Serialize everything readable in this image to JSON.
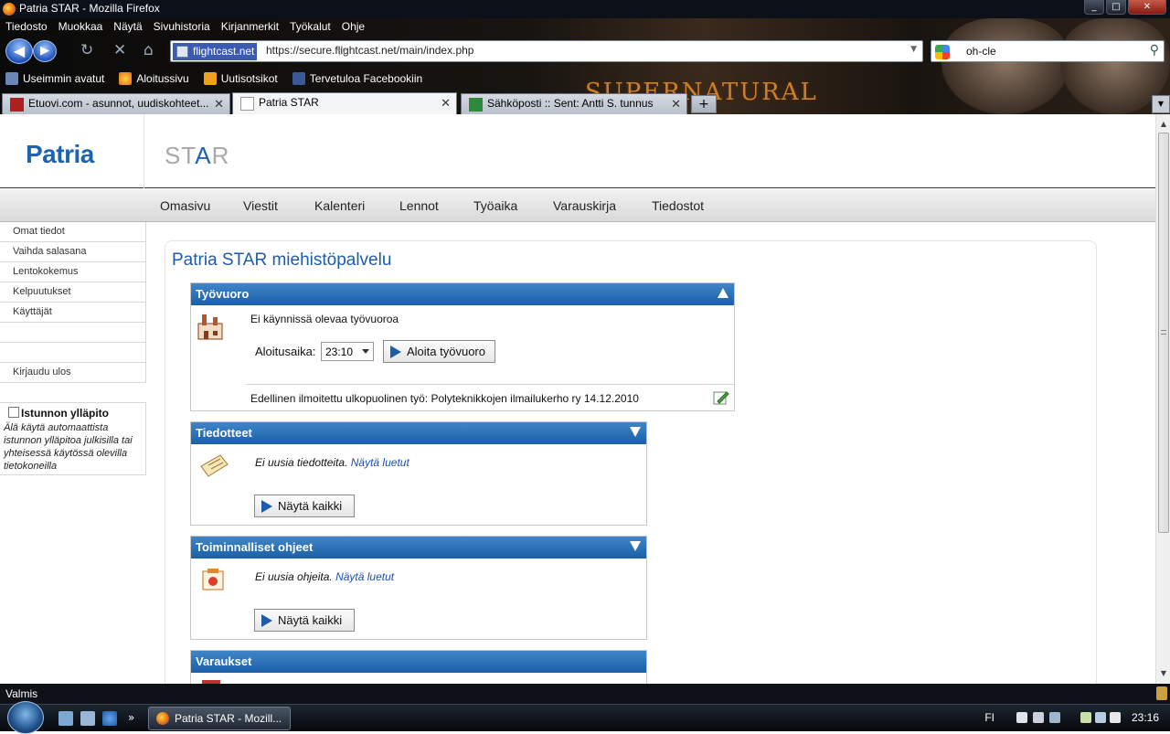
{
  "window": {
    "title": "Patria STAR - Mozilla Firefox",
    "buttons": [
      "_",
      "□",
      "✕"
    ]
  },
  "menu": [
    "Tiedosto",
    "Muokkaa",
    "Näytä",
    "Sivuhistoria",
    "Kirjanmerkit",
    "Työkalut",
    "Ohje"
  ],
  "nav": {
    "site": "flightcast.net",
    "url": "https://secure.flightcast.net/main/index.php",
    "search_value": "oh-cle"
  },
  "bookmarks": [
    "Useimmin avatut",
    "Aloitussivu",
    "Uutisotsikot",
    "Tervetuloa Facebookiin"
  ],
  "banner_text": "SUPERNATURAL",
  "tabs": [
    {
      "label": "Etuovi.com - asunnot, uudiskohteet..."
    },
    {
      "label": "Patria STAR"
    },
    {
      "label": "Sähköposti :: Sent: Antti S. tunnus"
    }
  ],
  "page": {
    "logo": "Patria",
    "product_prefix": "ST",
    "product_mid": "A",
    "product_suffix": "R",
    "topnav": [
      "Omasivu",
      "Viestit",
      "Kalenteri",
      "Lennot",
      "Työaika",
      "Varauskirja",
      "Tiedostot"
    ],
    "sidenav": [
      "Omat tiedot",
      "Vaihda salasana",
      "Lentokokemus",
      "Kelpuutukset",
      "Käyttäjät",
      "",
      "",
      "Kirjaudu ulos"
    ],
    "keep_session": {
      "label": "Istunnon ylläpito",
      "description": "Älä käytä automaattista istunnon ylläpitoa julkisilla tai yhteisessä käytössä olevilla tietokoneilla"
    },
    "title": "Patria STAR miehistöpalvelu",
    "tyovuoro": {
      "heading": "Työvuoro",
      "status": "Ei käynnissä olevaa työvuoroa",
      "start_label": "Aloitusaika:",
      "start_time": "23:10",
      "start_button": "Aloita työvuoro",
      "previous": "Edellinen ilmoitettu ulkopuolinen työ: Polyteknikkojen ilmailukerho ry 14.12.2010"
    },
    "tiedotteet": {
      "heading": "Tiedotteet",
      "text": "Ei uusia tiedotteita.",
      "link": "Näytä luetut",
      "button": "Näytä kaikki"
    },
    "ohjeet": {
      "heading": "Toiminnalliset ohjeet",
      "text": "Ei uusia ohjeita.",
      "link": "Näytä luetut",
      "button": "Näytä kaikki"
    },
    "varaukset": {
      "heading": "Varaukset"
    }
  },
  "status": "Valmis",
  "taskbar": {
    "task": "Patria STAR - Mozill...",
    "lang": "FI",
    "clock": "23:16"
  }
}
